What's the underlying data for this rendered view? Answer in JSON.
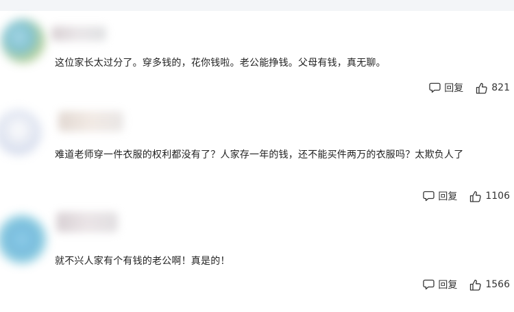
{
  "comments": [
    {
      "text": "这位家长太过分了。穿多钱的，花你钱啦。老公能挣钱。父母有钱，真无聊。",
      "reply_label": "回复",
      "like_count": "821"
    },
    {
      "text": "难道老师穿一件衣服的权利都没有了？人家存一年的钱，还不能买件两万的衣服吗？太欺负人了",
      "reply_label": "回复",
      "like_count": "1106"
    },
    {
      "text": "就不兴人家有个有钱的老公啊！真是的！",
      "reply_label": "回复",
      "like_count": "1566"
    }
  ],
  "icons": {
    "reply": "comment-bubble-icon",
    "like": "thumbs-up-icon"
  },
  "colors": {
    "text": "#222222",
    "action_text": "#333333",
    "top_band": "#f3f5f8"
  }
}
